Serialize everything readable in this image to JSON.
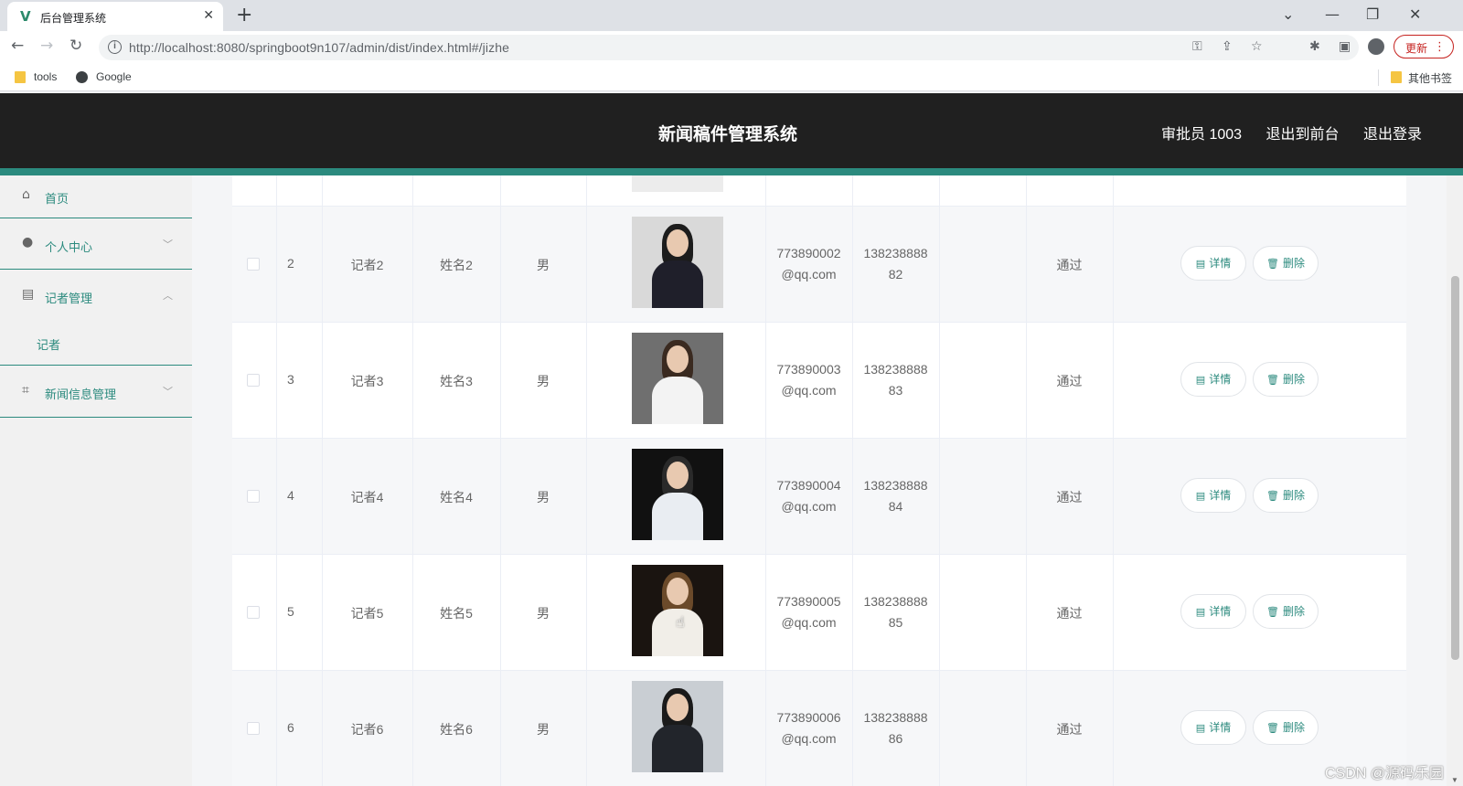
{
  "browser": {
    "tab_title": "后台管理系统",
    "tab_favicon": "V",
    "url": "http://localhost:8080/springboot9n107/admin/dist/index.html#/jizhe",
    "update_label": "更新",
    "bookmarks": [
      {
        "label": "tools",
        "icon": "folder-icon"
      },
      {
        "label": "Google",
        "icon": "globe-icon"
      }
    ],
    "other_bookmarks": "其他书签"
  },
  "header": {
    "title": "新闻稿件管理系统",
    "user": "审批员 1003",
    "to_front": "退出到前台",
    "logout": "退出登录"
  },
  "sidebar": {
    "items": [
      {
        "label": "首页",
        "icon": "home-icon",
        "arrow": ""
      },
      {
        "label": "个人中心",
        "icon": "user-icon",
        "arrow": "chevron-down-icon"
      },
      {
        "label": "记者管理",
        "icon": "card-icon",
        "arrow": "chevron-up-icon",
        "children": [
          {
            "label": "记者"
          }
        ]
      },
      {
        "label": "新闻信息管理",
        "icon": "crop-icon",
        "arrow": "chevron-down-icon"
      }
    ]
  },
  "table": {
    "rows": [
      {
        "index": "2",
        "account": "记者2",
        "name": "姓名2",
        "gender": "男",
        "email_1": "773890002",
        "email_2": "@qq.com",
        "phone_1": "138238888",
        "phone_2": "82",
        "status": "通过",
        "photo_desc": "woman-dark-blazer"
      },
      {
        "index": "3",
        "account": "记者3",
        "name": "姓名3",
        "gender": "男",
        "email_1": "773890003",
        "email_2": "@qq.com",
        "phone_1": "138238888",
        "phone_2": "83",
        "status": "通过",
        "photo_desc": "woman-white-shirt"
      },
      {
        "index": "4",
        "account": "记者4",
        "name": "姓名4",
        "gender": "男",
        "email_1": "773890004",
        "email_2": "@qq.com",
        "phone_1": "138238888",
        "phone_2": "84",
        "status": "通过",
        "photo_desc": "man-white-coat"
      },
      {
        "index": "5",
        "account": "记者5",
        "name": "姓名5",
        "gender": "男",
        "email_1": "773890005",
        "email_2": "@qq.com",
        "phone_1": "138238888",
        "phone_2": "85",
        "status": "通过",
        "photo_desc": "woman-white-seated"
      },
      {
        "index": "6",
        "account": "记者6",
        "name": "姓名6",
        "gender": "男",
        "email_1": "773890006",
        "email_2": "@qq.com",
        "phone_1": "138238888",
        "phone_2": "86",
        "status": "通过",
        "photo_desc": "woman-arms-crossed"
      }
    ],
    "detail_label": "详情",
    "delete_label": "删除"
  },
  "watermark": "CSDN @源码乐园",
  "colors": {
    "accent": "#2b8a7e",
    "header_bg": "#202020"
  }
}
